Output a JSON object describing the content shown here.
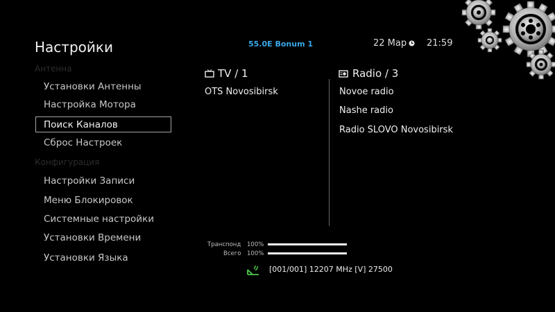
{
  "header": {
    "title": "Настройки",
    "satellite": "55.0E Bonum 1",
    "date": "22 Мар",
    "time": "21:59"
  },
  "menu": {
    "categories": [
      "Антенна",
      "Конфигурация"
    ],
    "items": [
      {
        "label": "Установки Антенны",
        "selected": false
      },
      {
        "label": "Настройка Мотора",
        "selected": false
      },
      {
        "label": "Поиск Каналов",
        "selected": true
      },
      {
        "label": "Сброс Настроек",
        "selected": false
      },
      {
        "label": "Настройки Записи",
        "selected": false
      },
      {
        "label": "Меню Блокировок",
        "selected": false
      },
      {
        "label": "Системные настройки",
        "selected": false
      },
      {
        "label": "Установки Времени",
        "selected": false
      },
      {
        "label": "Установки Языка",
        "selected": false
      }
    ]
  },
  "tv": {
    "header": "TV / 1",
    "channels": [
      "OTS Novosibirsk"
    ]
  },
  "radio": {
    "header": "Radio / 3",
    "channels": [
      "Novoe radio",
      "Nashe radio",
      "Radio SLOVO Novosibirsk"
    ]
  },
  "signal": {
    "transponder_label": "Транспонд",
    "transponder_value": "100%",
    "transponder_level": 1.0,
    "total_label": "Всего",
    "total_value": "100%",
    "total_level": 1.0,
    "info": "[001/001] 12207 MHz [V] 27500"
  },
  "icons": {
    "tv": "tv-icon",
    "radio": "radio-icon",
    "clock": "clock-icon",
    "satellite": "satellite-dish-icon",
    "decor": "gears-decoration"
  },
  "colors": {
    "satellite_text": "#38a8e8",
    "satellite_icon": "#4cc84c",
    "selection_border": "#a5a5a5"
  }
}
